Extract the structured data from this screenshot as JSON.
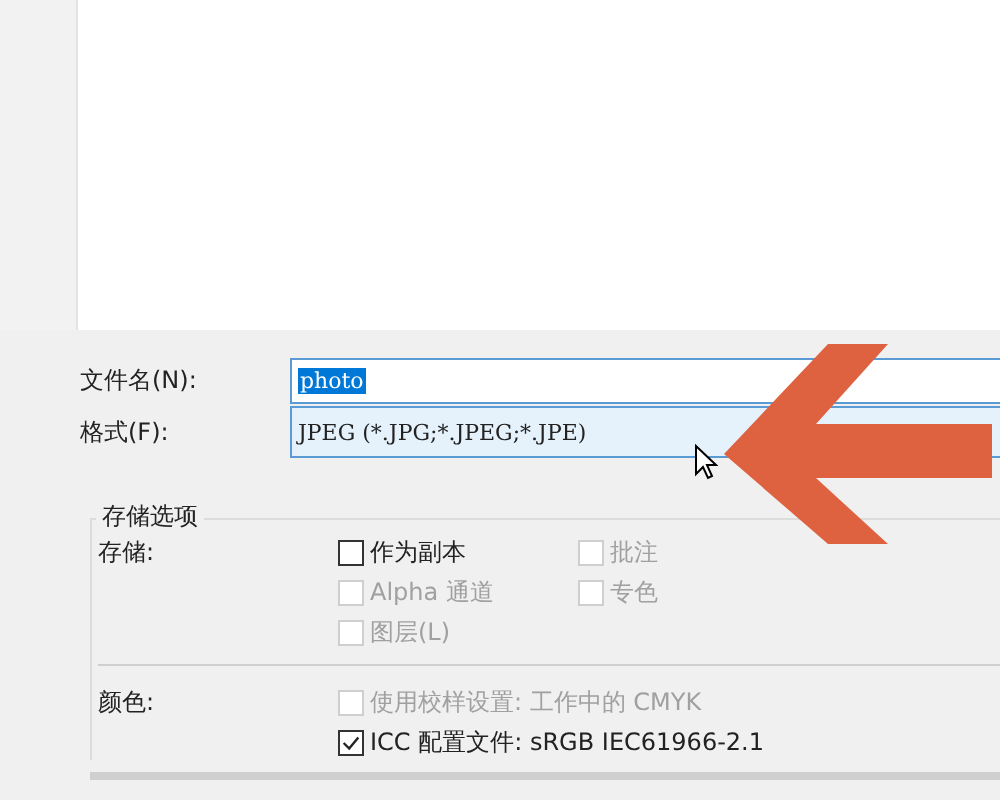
{
  "file_name": {
    "label": "文件名(N):",
    "value": "photo",
    "selected": true
  },
  "format": {
    "label": "格式(F):",
    "value": "JPEG (*.JPG;*.JPEG;*.JPE)"
  },
  "save_options": {
    "title": "存储选项",
    "save_label": "存储:",
    "checkboxes": [
      {
        "label": "作为副本",
        "checked": false,
        "disabled": false
      },
      {
        "label": "批注",
        "checked": false,
        "disabled": true
      },
      {
        "label": "Alpha 通道",
        "checked": false,
        "disabled": true
      },
      {
        "label": "专色",
        "checked": false,
        "disabled": true
      },
      {
        "label": "图层(L)",
        "checked": false,
        "disabled": true
      }
    ],
    "color_label": "颜色:",
    "color_checkboxes": [
      {
        "label": "使用校样设置: 工作中的 CMYK",
        "checked": false,
        "disabled": true
      },
      {
        "label": "ICC 配置文件: sRGB IEC61966-2.1",
        "checked": true,
        "disabled": false
      }
    ]
  }
}
